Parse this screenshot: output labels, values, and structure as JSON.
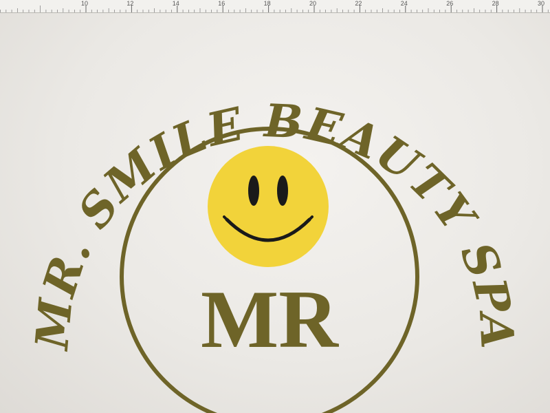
{
  "ruler": {
    "labels": [
      "10",
      "12",
      "14",
      "16",
      "18",
      "20",
      "22",
      "24",
      "26",
      "28",
      "30"
    ]
  },
  "logo": {
    "arc_text": "MR. SMILE BEAUTY SPA",
    "initials": "MR",
    "colors": {
      "ink": "#6e6428",
      "smiley_face": "#f2d33a",
      "smiley_features": "#1a1a1a"
    },
    "icons": [
      "smiley-face-icon"
    ]
  }
}
